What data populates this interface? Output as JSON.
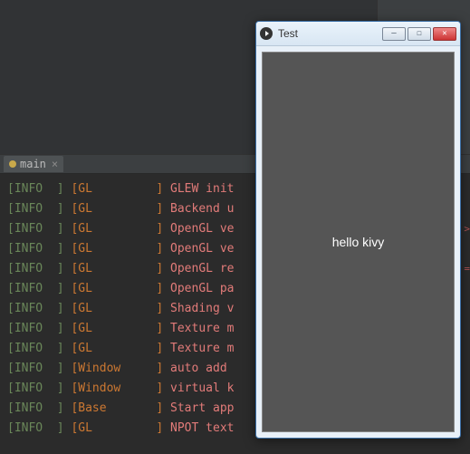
{
  "tab": {
    "label": "main",
    "close_glyph": "×"
  },
  "console": {
    "lines": [
      {
        "level": "INFO",
        "tag": "GL",
        "msg": "GLEW init"
      },
      {
        "level": "INFO",
        "tag": "GL",
        "msg": "Backend u"
      },
      {
        "level": "INFO",
        "tag": "GL",
        "msg": "OpenGL ve"
      },
      {
        "level": "INFO",
        "tag": "GL",
        "msg": "OpenGL ve"
      },
      {
        "level": "INFO",
        "tag": "GL",
        "msg": "OpenGL re"
      },
      {
        "level": "INFO",
        "tag": "GL",
        "msg": "OpenGL pa"
      },
      {
        "level": "INFO",
        "tag": "GL",
        "msg": "Shading v"
      },
      {
        "level": "INFO",
        "tag": "GL",
        "msg": "Texture m"
      },
      {
        "level": "INFO",
        "tag": "GL",
        "msg": "Texture m"
      },
      {
        "level": "INFO",
        "tag": "Window",
        "msg": "auto add "
      },
      {
        "level": "INFO",
        "tag": "Window",
        "msg": "virtual k"
      },
      {
        "level": "INFO",
        "tag": "Base",
        "msg": "Start app"
      },
      {
        "level": "INFO",
        "tag": "GL",
        "msg": "NPOT text"
      }
    ],
    "markers": [
      {
        "row": 2,
        "glyph": ">"
      },
      {
        "row": 4,
        "glyph": "="
      }
    ]
  },
  "window": {
    "title": "Test",
    "buttons": {
      "min": "—",
      "max": "☐",
      "close": "✕"
    },
    "content_label": "hello kivy"
  }
}
